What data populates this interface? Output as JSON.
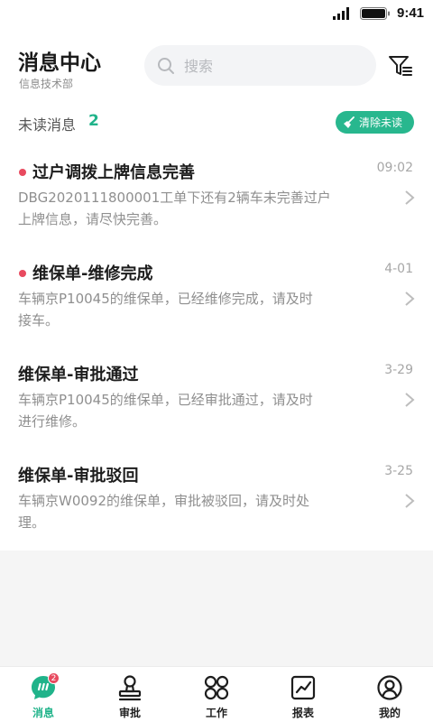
{
  "status_bar": {
    "time": "9:41"
  },
  "header": {
    "title": "消息中心",
    "subtitle": "信息技术部",
    "search_placeholder": "搜索"
  },
  "unread": {
    "label": "未读消息",
    "count": "2",
    "clear_label": "清除未读"
  },
  "messages": [
    {
      "title": "过户调拨上牌信息完善",
      "time": "09:02",
      "line1": "DBG2020111800001工单下还有2辆车未完善过户",
      "line2": "上牌信息，请尽快完善。",
      "unread": true
    },
    {
      "title": "维保单-维修完成",
      "time": "4-01",
      "line1": "车辆京P10045的维保单，已经维修完成，请及时",
      "line2": "接车。",
      "unread": true
    },
    {
      "title": "维保单-审批通过",
      "time": "3-29",
      "line1": "车辆京P10045的维保单，已经审批通过，请及时",
      "line2": "进行维修。",
      "unread": false
    },
    {
      "title": "维保单-审批驳回",
      "time": "3-25",
      "line1": "车辆京W0092的维保单，审批被驳回，请及时处",
      "line2": "理。",
      "unread": false
    }
  ],
  "tabs": [
    {
      "label": "消息",
      "icon": "chat-icon",
      "active": true,
      "badge": "2"
    },
    {
      "label": "审批",
      "icon": "stamp-icon",
      "active": false
    },
    {
      "label": "工作",
      "icon": "grid-icon",
      "active": false
    },
    {
      "label": "报表",
      "icon": "chart-icon",
      "active": false
    },
    {
      "label": "我的",
      "icon": "user-icon",
      "active": false
    }
  ],
  "colors": {
    "accent": "#20b38a",
    "unread_dot": "#e84a5f"
  }
}
